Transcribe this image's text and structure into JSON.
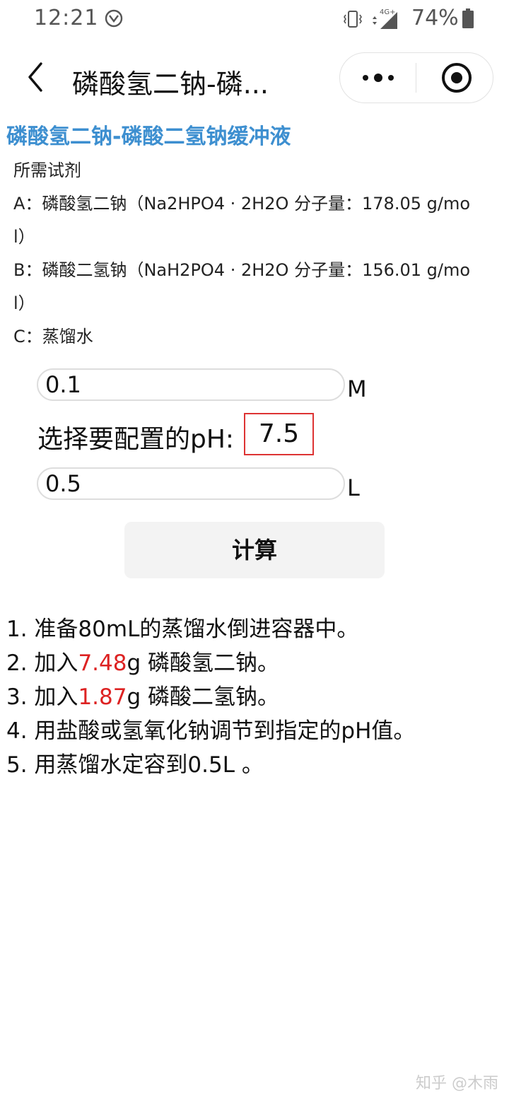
{
  "status_bar": {
    "time": "12:21",
    "network": "4G+",
    "battery": "74%"
  },
  "nav": {
    "title": "磷酸氢二钠-磷..."
  },
  "content": {
    "heading": "磷酸氢二钠-磷酸二氢钠缓冲液",
    "reagents": [
      "所需试剂",
      "A：磷酸氢二钠（Na2HPO4 · 2H2O 分子量：178.05 g/mol）",
      "B：磷酸二氢钠（NaH2PO4 · 2H2O 分子量：156.01 g/mol）",
      "C：蒸馏水"
    ],
    "concentration": {
      "value": "0.1",
      "unit": "M"
    },
    "ph": {
      "label": "选择要配置的pH:",
      "value": "7.5"
    },
    "volume": {
      "value": "0.5",
      "unit": "L"
    },
    "calculate_label": "计算",
    "steps": {
      "s1": "1. 准备80mL的蒸馏水倒进容器中。",
      "s2_prefix": "2. 加入",
      "s2_value": "7.48",
      "s2_suffix": "g 磷酸氢二钠。",
      "s3_prefix": "3. 加入",
      "s3_value": "1.87",
      "s3_suffix": "g 磷酸二氢钠。",
      "s4": "4. 用盐酸或氢氧化钠调节到指定的pH值。",
      "s5": "5. 用蒸馏水定容到0.5L 。"
    }
  },
  "watermark": "知乎 @木雨",
  "colors": {
    "heading": "#3d8fd0",
    "highlight": "#d22222",
    "ph_border": "#d33333"
  }
}
